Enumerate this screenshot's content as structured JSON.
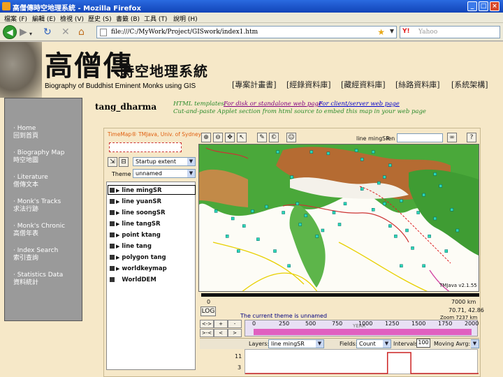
{
  "window": {
    "title": "高僧傳時空地理系統 - Mozilla Firefox"
  },
  "menu": [
    "檔案 (F)",
    "編輯 (E)",
    "檢視 (V)",
    "歷史 (S)",
    "書籤 (B)",
    "工具 (T)",
    "說明 (H)"
  ],
  "toolbar": {
    "url": "file:///C:/MyWork/Project/GISwork/index1.htm",
    "search_placeholder": "Yahoo",
    "search_engine_label": "Y!"
  },
  "banner": {
    "title_big": "高僧傳",
    "title_small": "時空地理系統",
    "subtitle": "Biography of Buddhist Eminent Monks using GIS",
    "nav": [
      "[專案計畫書]",
      "[經錄資料庫]",
      "[藏經資料庫]",
      "[絲路資料庫]",
      "[系統架構]"
    ]
  },
  "sidebar": {
    "items": [
      {
        "en": "Home",
        "zh": "回到首頁"
      },
      {
        "en": "Biography Map",
        "zh": "時空地圖"
      },
      {
        "en": "Literature",
        "zh": "僧傳文本"
      },
      {
        "en": "Monk's Tracks",
        "zh": "求法行跡"
      },
      {
        "en": "Monk's Chronic",
        "zh": "高僧年表"
      },
      {
        "en": "Index Search",
        "zh": "索引查詢"
      },
      {
        "en": "Statistics Data",
        "zh": "資料統計"
      }
    ]
  },
  "map_header": {
    "name": "tang_dharma",
    "templates_label": "HTML templates:",
    "link_disk": "For disk or standalone web page",
    "link_client": "For client/server web page",
    "note": "Cut-and-paste Applet section from html source to embed this map in your web page"
  },
  "applet": {
    "brand": "TimeMap® TMJava, Univ. of Sydney",
    "extent_value": "Startup extent",
    "theme_label": "Theme",
    "theme_value": "unnamed",
    "layers": [
      "line mingSR",
      "line yuanSR",
      "line soongSR",
      "line tangSR",
      "point ktang",
      "line tang",
      "polygon tang",
      "worldkeymap",
      "WorldDEM"
    ],
    "selected_layer": "line mingSR",
    "len_label": "len",
    "version": "TMJava v2.1.55",
    "scale_start": "0",
    "scale_end": "7000 km",
    "log_button": "LOG",
    "coords": "70.71, 42.86",
    "zoom_text": "Zoom 7237 km",
    "theme_status": "The current theme is unnamed",
    "timeline_ticks": [
      "0",
      "250",
      "500",
      "750",
      "1000",
      "1250",
      "1500",
      "1750",
      "2000"
    ],
    "timeline_caption": "YEAR",
    "nav_buttons": [
      "<->",
      "+",
      "-",
      ">-<",
      "<",
      ">"
    ],
    "layers_label": "Layers:",
    "layers_select": "line mingSR",
    "fields_label": "Fields:",
    "fields_select": "Count",
    "intervals_label": "Intervals:",
    "intervals_value": "100",
    "moving_label": "Moving Avrg:",
    "hist_y": [
      "11",
      "3"
    ]
  },
  "colors": {
    "page_bg": "#f6e8c8",
    "sidebar_bg": "#9a9a9a",
    "accent_red": "#cc2222",
    "link_purple": "#800080",
    "link_blue": "#0000cc",
    "brand_orange": "#e06010"
  },
  "map_points": [
    [
      0.06,
      0.45
    ],
    [
      0.1,
      0.62
    ],
    [
      0.12,
      0.5
    ],
    [
      0.14,
      0.72
    ],
    [
      0.16,
      0.55
    ],
    [
      0.19,
      0.45
    ],
    [
      0.21,
      0.64
    ],
    [
      0.24,
      0.42
    ],
    [
      0.27,
      0.72
    ],
    [
      0.28,
      0.05
    ],
    [
      0.3,
      0.46
    ],
    [
      0.32,
      0.82
    ],
    [
      0.33,
      0.22
    ],
    [
      0.35,
      0.4
    ],
    [
      0.36,
      0.54
    ],
    [
      0.38,
      0.48
    ],
    [
      0.4,
      0.05
    ],
    [
      0.42,
      0.62
    ],
    [
      0.44,
      0.58
    ],
    [
      0.46,
      0.06
    ],
    [
      0.48,
      0.46
    ],
    [
      0.5,
      0.54
    ],
    [
      0.52,
      0.4
    ],
    [
      0.56,
      0.04
    ],
    [
      0.58,
      0.1
    ],
    [
      0.62,
      0.05
    ],
    [
      0.64,
      0.26
    ],
    [
      0.66,
      0.22
    ],
    [
      0.68,
      0.14
    ],
    [
      0.66,
      0.4
    ],
    [
      0.68,
      0.55
    ],
    [
      0.7,
      0.62
    ],
    [
      0.72,
      0.38
    ],
    [
      0.74,
      0.58
    ],
    [
      0.76,
      0.7
    ],
    [
      0.78,
      0.46
    ],
    [
      0.8,
      0.34
    ],
    [
      0.82,
      0.62
    ],
    [
      0.84,
      0.5
    ],
    [
      0.86,
      0.28
    ],
    [
      0.88,
      0.72
    ],
    [
      0.9,
      0.44
    ],
    [
      0.92,
      0.58
    ],
    [
      0.72,
      0.82
    ],
    [
      0.8,
      0.82
    ],
    [
      0.84,
      0.2
    ],
    [
      0.62,
      0.44
    ],
    [
      0.58,
      0.3
    ]
  ],
  "histogram": [
    0,
    0,
    0,
    0,
    0,
    0,
    0,
    0,
    0,
    0,
    0,
    0,
    0,
    0,
    0,
    0,
    0,
    0,
    0,
    0,
    0,
    0,
    0,
    0,
    0,
    0,
    0,
    0,
    0,
    0,
    0,
    0,
    0,
    0,
    0,
    0,
    0,
    0,
    0,
    0,
    0,
    0,
    0,
    0,
    0,
    0,
    0,
    0,
    0,
    0,
    0,
    0,
    0,
    0,
    0,
    0,
    0,
    0,
    0,
    0,
    0,
    11,
    11,
    11,
    11,
    11,
    11,
    11,
    11,
    11,
    11,
    0,
    0,
    0,
    0,
    0,
    0,
    0,
    0,
    0,
    0,
    0,
    0,
    0,
    0,
    0,
    0,
    0,
    0,
    0,
    0,
    0,
    0,
    0,
    0,
    0,
    0,
    0,
    0,
    0
  ]
}
